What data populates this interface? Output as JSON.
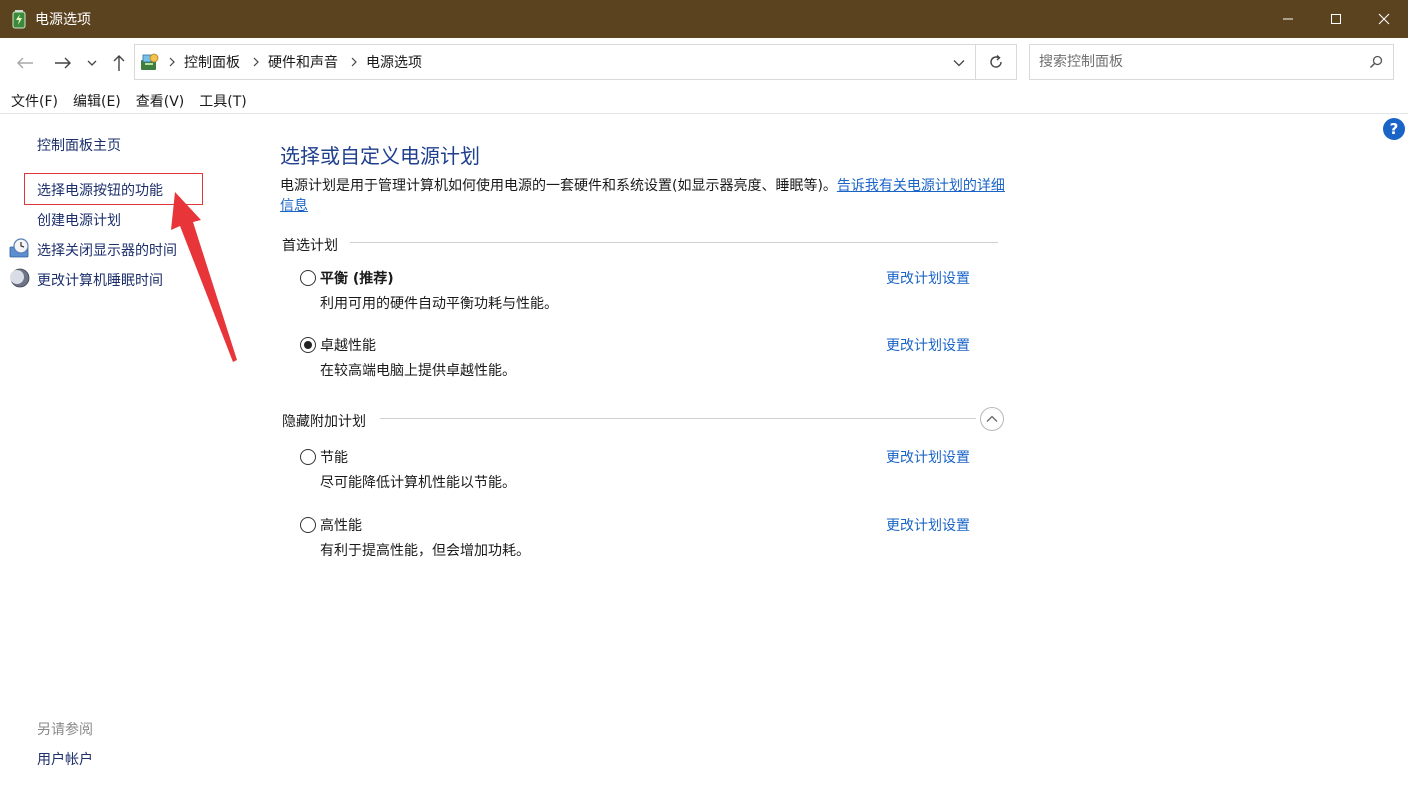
{
  "window": {
    "title": "电源选项",
    "app_icon": "battery-power-icon"
  },
  "address_bar": {
    "breadcrumbs": [
      "控制面板",
      "硬件和声音",
      "电源选项"
    ],
    "search_placeholder": "搜索控制面板"
  },
  "menu": {
    "items": [
      "文件(F)",
      "编辑(E)",
      "查看(V)",
      "工具(T)"
    ]
  },
  "sidebar": {
    "home": "控制面板主页",
    "links": [
      {
        "label": "选择电源按钮的功能",
        "icon": ""
      },
      {
        "label": "创建电源计划",
        "icon": ""
      },
      {
        "label": "选择关闭显示器的时间",
        "icon": "monitor-clock-icon"
      },
      {
        "label": "更改计算机睡眠时间",
        "icon": "moon-icon"
      }
    ],
    "see_also_title": "另请参阅",
    "see_also_links": [
      "用户帐户"
    ]
  },
  "main": {
    "title": "选择或自定义电源计划",
    "description": "电源计划是用于管理计算机如何使用电源的一套硬件和系统设置(如显示器亮度、睡眠等)。",
    "description_link": "告诉我有关电源计划的详细信息",
    "preferred_header": "首选计划",
    "hidden_header": "隐藏附加计划",
    "plans": [
      {
        "name": "平衡 (推荐)",
        "desc": "利用可用的硬件自动平衡功耗与性能。",
        "link": "更改计划设置",
        "selected": false
      },
      {
        "name": "卓越性能",
        "desc": "在较高端电脑上提供卓越性能。",
        "link": "更改计划设置",
        "selected": true
      },
      {
        "name": "节能",
        "desc": "尽可能降低计算机性能以节能。",
        "link": "更改计划设置",
        "selected": false
      },
      {
        "name": "高性能",
        "desc": "有利于提高性能，但会增加功耗。",
        "link": "更改计划设置",
        "selected": false
      }
    ]
  },
  "colors": {
    "titlebar": "#5c4320",
    "link": "#1a64c8",
    "title_text": "#1f3f8f",
    "highlight": "#e0353a"
  }
}
